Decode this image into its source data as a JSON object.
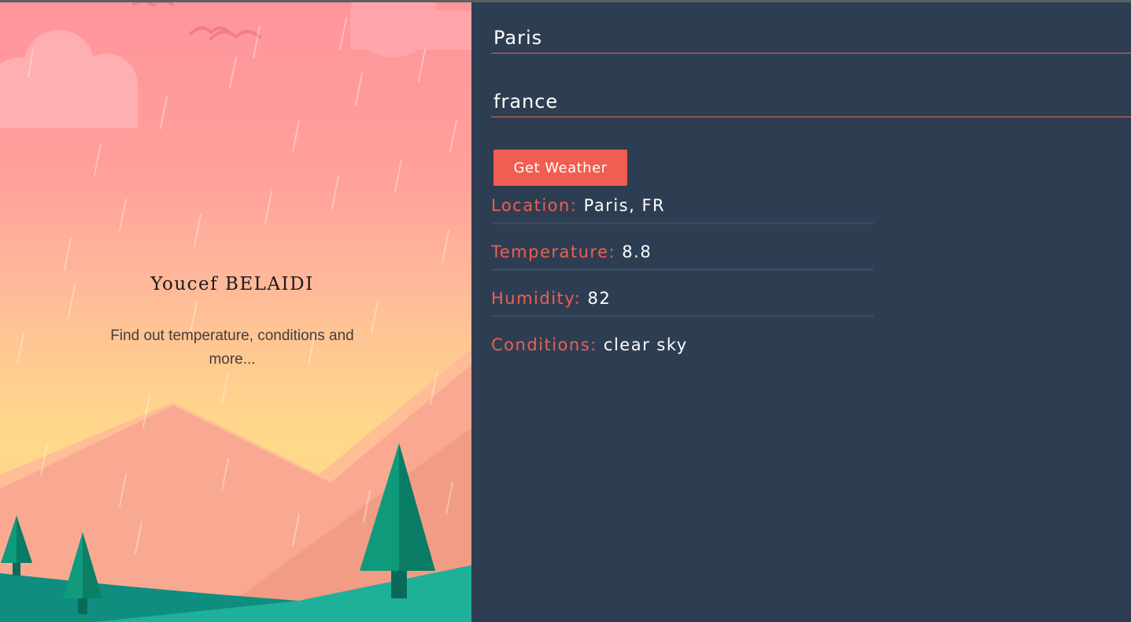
{
  "hero": {
    "title": "Youcef BELAIDI",
    "subtitle": "Find out temperature, conditions and more..."
  },
  "form": {
    "city_value": "Paris",
    "country_value": "france",
    "submit_label": "Get Weather"
  },
  "results": [
    {
      "label": "Location:",
      "value": "Paris, FR"
    },
    {
      "label": "Temperature:",
      "value": "8.8"
    },
    {
      "label": "Humidity:",
      "value": "82"
    },
    {
      "label": "Conditions:",
      "value": "clear sky"
    }
  ],
  "colors": {
    "panel_bg": "#2e3e52",
    "accent": "#ef5e50",
    "divider": "#374a60"
  }
}
